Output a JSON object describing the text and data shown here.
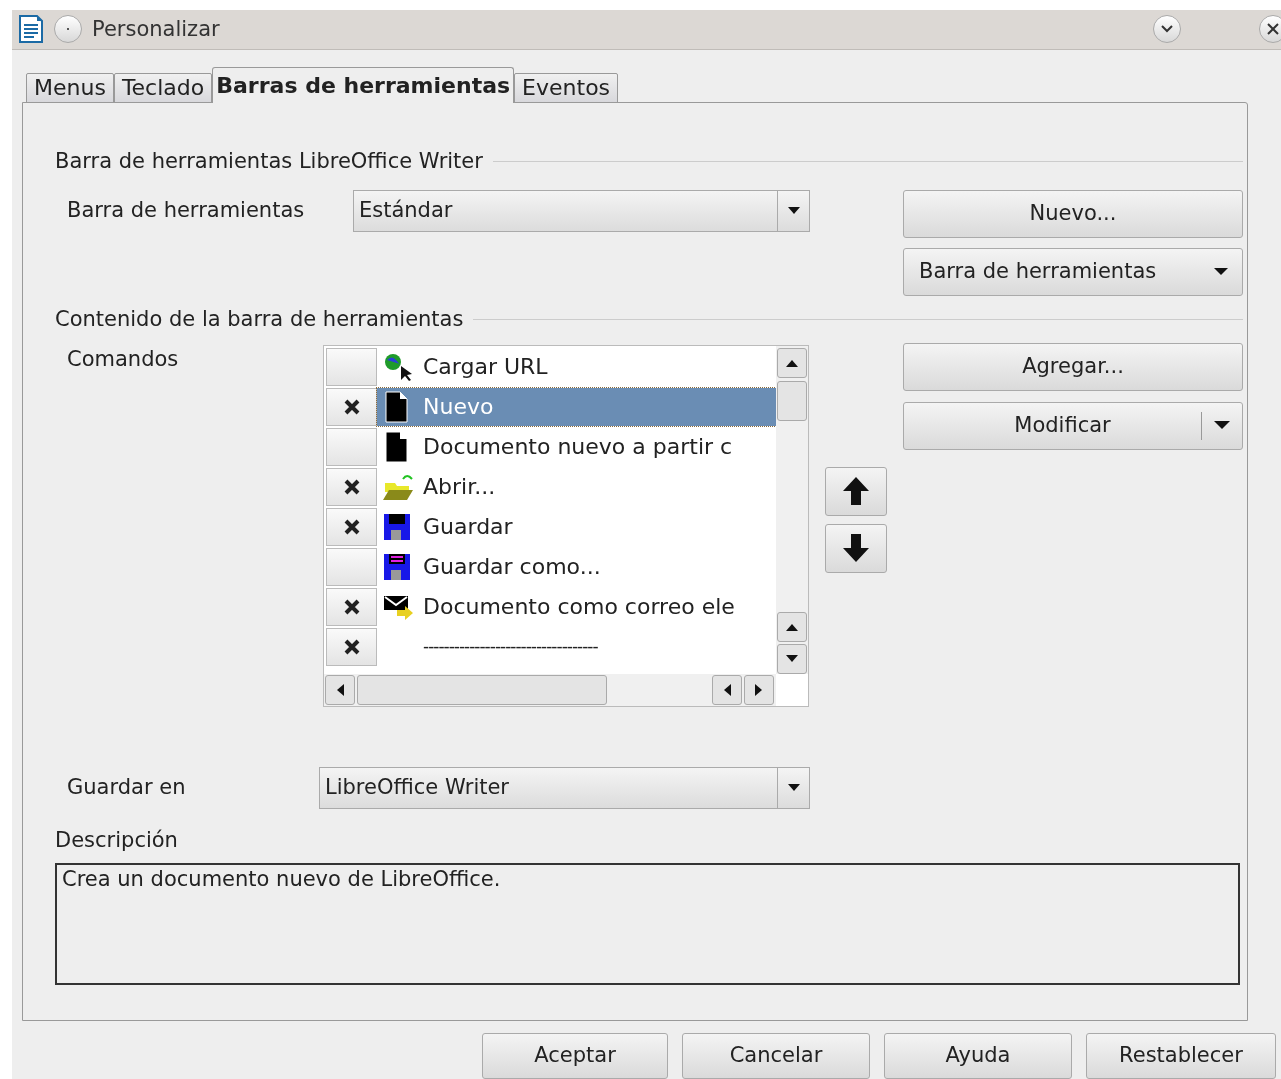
{
  "window": {
    "title": "Personalizar"
  },
  "tabs": [
    {
      "label": "Menus",
      "selected": false
    },
    {
      "label": "Teclado",
      "selected": false
    },
    {
      "label": "Barras de herramientas",
      "selected": true
    },
    {
      "label": "Eventos",
      "selected": false
    }
  ],
  "toolbar_section": {
    "heading": "Barra de herramientas LibreOffice Writer",
    "toolbar_label": "Barra de herramientas",
    "toolbar_value": "Estándar",
    "new_button": "Nuevo...",
    "toolbar_menu_button": "Barra de herramientas"
  },
  "content_section": {
    "heading": "Contenido de la barra de herramientas",
    "commands_label": "Comandos",
    "commands": [
      {
        "kind": "command",
        "label": "Cargar URL",
        "checked": false,
        "selected": false
      },
      {
        "kind": "command",
        "label": "Nuevo",
        "checked": true,
        "selected": true
      },
      {
        "kind": "command",
        "label": "Documento nuevo a partir c",
        "checked": false,
        "selected": false
      },
      {
        "kind": "command",
        "label": "Abrir...",
        "checked": true,
        "selected": false
      },
      {
        "kind": "command",
        "label": "Guardar",
        "checked": true,
        "selected": false
      },
      {
        "kind": "command",
        "label": "Guardar como...",
        "checked": false,
        "selected": false
      },
      {
        "kind": "command",
        "label": "Documento como correo ele",
        "checked": true,
        "selected": false
      },
      {
        "kind": "separator",
        "label": "----------------------------------",
        "checked": true,
        "selected": false
      }
    ],
    "add_button": "Agregar...",
    "modify_button": "Modificar"
  },
  "save_in": {
    "label": "Guardar en",
    "value": "LibreOffice Writer"
  },
  "description": {
    "label": "Descripción",
    "text": "Crea un documento nuevo de LibreOffice."
  },
  "buttons": [
    "Aceptar",
    "Cancelar",
    "Ayuda",
    "Restablecer"
  ]
}
